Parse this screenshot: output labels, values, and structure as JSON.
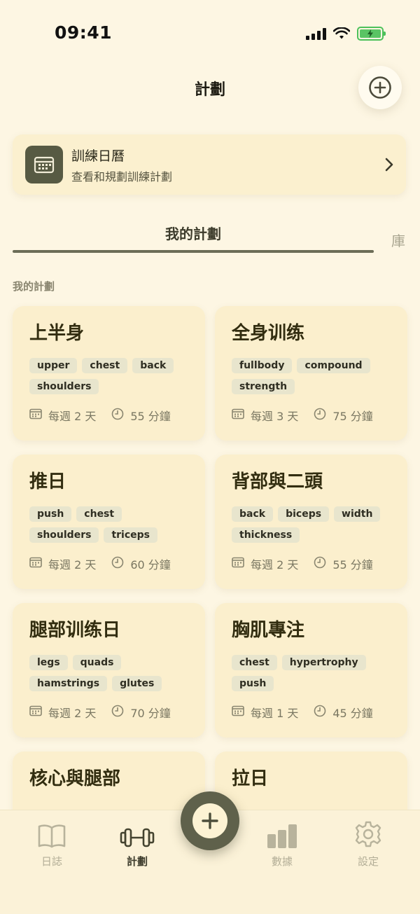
{
  "status_bar": {
    "time": "09:41"
  },
  "header": {
    "title": "計劃"
  },
  "calendar_card": {
    "title": "訓練日曆",
    "subtitle": "查看和規劃訓練計劃"
  },
  "tabs": {
    "active": "我的計劃",
    "other": "庫"
  },
  "section_label": "我的計劃",
  "plans": [
    {
      "title": "上半身",
      "tags": [
        "upper",
        "chest",
        "back",
        "shoulders"
      ],
      "frequency": "每週 2 天",
      "duration": "55 分鐘"
    },
    {
      "title": "全身训练",
      "tags": [
        "fullbody",
        "compound",
        "strength"
      ],
      "frequency": "每週 3 天",
      "duration": "75 分鐘"
    },
    {
      "title": "推日",
      "tags": [
        "push",
        "chest",
        "shoulders",
        "triceps"
      ],
      "frequency": "每週 2 天",
      "duration": "60 分鐘"
    },
    {
      "title": "背部與二頭",
      "tags": [
        "back",
        "biceps",
        "width",
        "thickness"
      ],
      "frequency": "每週 2 天",
      "duration": "55 分鐘"
    },
    {
      "title": "腿部训练日",
      "tags": [
        "legs",
        "quads",
        "hamstrings",
        "glutes"
      ],
      "frequency": "每週 2 天",
      "duration": "70 分鐘"
    },
    {
      "title": "胸肌專注",
      "tags": [
        "chest",
        "hypertrophy",
        "push"
      ],
      "frequency": "每週 1 天",
      "duration": "45 分鐘"
    },
    {
      "title": "核心與腿部",
      "tags": [],
      "frequency": "",
      "duration": ""
    },
    {
      "title": "拉日",
      "tags": [],
      "frequency": "",
      "duration": ""
    }
  ],
  "tabbar": {
    "items": [
      {
        "label": "日誌",
        "icon": "book-icon"
      },
      {
        "label": "計劃",
        "icon": "dumbbell-icon"
      },
      {
        "label": "數據",
        "icon": "bar-chart-icon"
      },
      {
        "label": "設定",
        "icon": "gear-icon"
      }
    ]
  },
  "colors": {
    "background": "#fdf6e3",
    "card": "#fbefcd",
    "accent": "#5f614b",
    "tag": "#e8e5cd"
  }
}
